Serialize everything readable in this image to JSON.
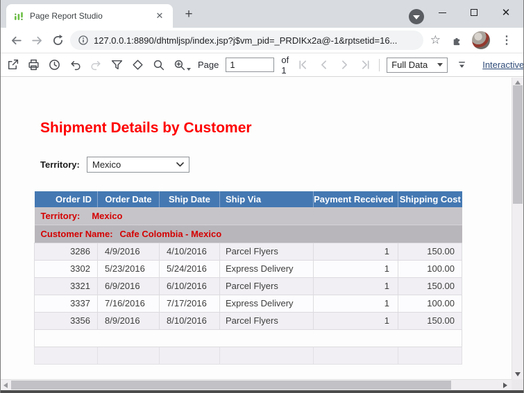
{
  "browser": {
    "tab_title": "Page Report Studio",
    "url": "127.0.0.1:8890/dhtmljsp/index.jsp?j$vm_pid=_PRDIKx2a@-1&rptsetid=16...",
    "icons": {
      "tab_close": "✕",
      "new_tab": "+",
      "bookmark_star": "☆",
      "menu_dots": "⋮",
      "window_close": "✕"
    }
  },
  "toolbar": {
    "page_label": "Page",
    "page_value": "1",
    "page_total_label": "of 1",
    "view_mode_value": "Full Data",
    "interactive_view_label": "Interactive View"
  },
  "report": {
    "title": "Shipment Details by Customer",
    "parameter": {
      "label": "Territory:",
      "value": "Mexico"
    },
    "table": {
      "columns": [
        "Order ID",
        "Order Date",
        "Ship Date",
        "Ship Via",
        "Payment Received",
        "Shipping Cost"
      ],
      "groups": {
        "territory": {
          "label": "Territory:",
          "value": "Mexico"
        },
        "customer": {
          "label": "Customer Name:",
          "value": "Cafe Colombia - Mexico"
        }
      },
      "rows": [
        [
          "3286",
          "4/9/2016",
          "4/10/2016",
          "Parcel Flyers",
          "1",
          "150.00"
        ],
        [
          "3302",
          "5/23/2016",
          "5/24/2016",
          "Express Delivery",
          "1",
          "100.00"
        ],
        [
          "3321",
          "6/9/2016",
          "6/10/2016",
          "Parcel Flyers",
          "1",
          "150.00"
        ],
        [
          "3337",
          "7/16/2016",
          "7/17/2016",
          "Express Delivery",
          "1",
          "100.00"
        ],
        [
          "3356",
          "8/9/2016",
          "8/10/2016",
          "Parcel Flyers",
          "1",
          "150.00"
        ]
      ]
    }
  },
  "colors": {
    "table_header_bg": "#4478B2",
    "title_red": "#FE0000",
    "group_text_red": "#D40000",
    "territory_row_bg": "#C6C4C8",
    "customer_row_bg": "#B9B6BB",
    "row_alt_bg": "#F1EFF3",
    "favicon_green": "#6CBF45"
  }
}
